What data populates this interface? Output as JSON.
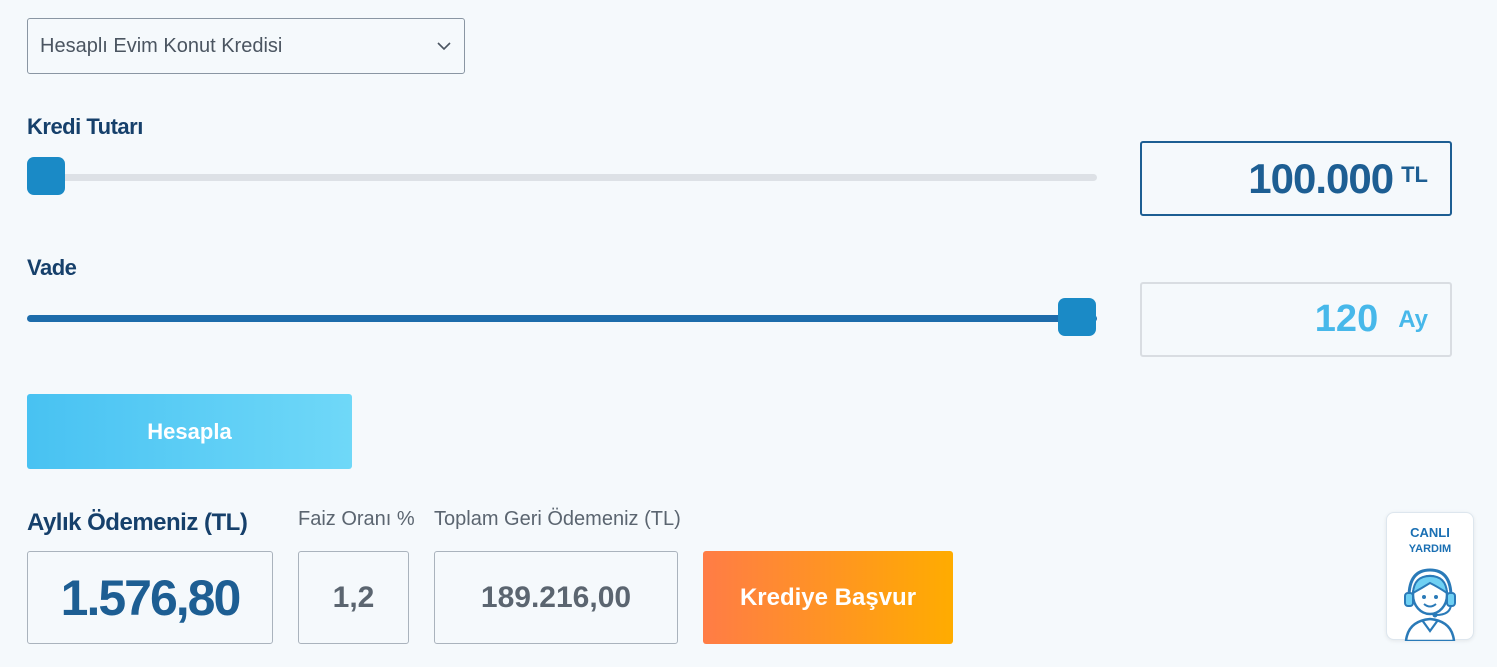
{
  "product_select": {
    "selected": "Hesaplı Evim Konut Kredisi"
  },
  "loan_amount": {
    "label": "Kredi Tutarı",
    "value": "100.000",
    "unit": "TL",
    "slider_fraction": 0.0
  },
  "term": {
    "label": "Vade",
    "value": "120",
    "unit": "Ay",
    "slider_fraction": 1.0
  },
  "calculate_button": {
    "label": "Hesapla"
  },
  "results": {
    "monthly_payment": {
      "label": "Aylık Ödemeniz (TL)",
      "value": "1.576,80"
    },
    "interest_rate": {
      "label": "Faiz Oranı %",
      "value": "1,2"
    },
    "total_repayment": {
      "label": "Toplam Geri Ödemeniz (TL)",
      "value": "189.216,00"
    }
  },
  "apply_button": {
    "label": "Krediye Başvur"
  },
  "live_help": {
    "line1": "CANLI",
    "line2": "YARDIM"
  },
  "colors": {
    "accent_blue": "#1a8ac6",
    "dark_blue": "#16406b",
    "track_gray": "#dde1e6",
    "orange_start": "#ff7c46",
    "orange_end": "#ffac00"
  }
}
